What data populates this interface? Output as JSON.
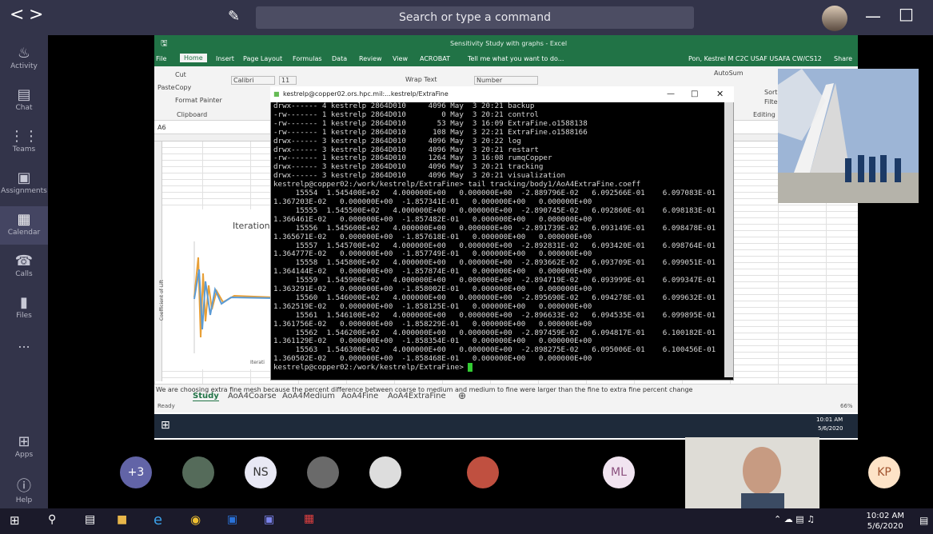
{
  "teams": {
    "search_placeholder": "Search or type a command",
    "nav_back": "<",
    "nav_forward": ">",
    "rail": [
      {
        "label": "Activity",
        "icon": "bell-icon"
      },
      {
        "label": "Chat",
        "icon": "chat-icon"
      },
      {
        "label": "Teams",
        "icon": "teams-icon"
      },
      {
        "label": "Assignments",
        "icon": "assignments-icon"
      },
      {
        "label": "Calendar",
        "icon": "calendar-icon"
      },
      {
        "label": "Calls",
        "icon": "phone-icon"
      },
      {
        "label": "Files",
        "icon": "files-icon"
      },
      {
        "label": "...",
        "icon": "more-icon"
      },
      {
        "label": "Apps",
        "icon": "apps-icon"
      },
      {
        "label": "Help",
        "icon": "help-icon"
      }
    ],
    "participants": [
      {
        "label": "+3",
        "color": "#6264a7"
      },
      {
        "label": "",
        "color": "#7a7a7a"
      },
      {
        "label": "NS",
        "color": "#e8e8f4"
      },
      {
        "label": "",
        "color": "#8a8a8a"
      },
      {
        "label": "",
        "color": "#9a9a9a"
      },
      {
        "label": "",
        "color": "#b04040"
      },
      {
        "label": "ML",
        "color": "#f1e4f0"
      },
      {
        "label": "KP",
        "color": "#fde3c7"
      }
    ]
  },
  "excel": {
    "window_title": "Sensitivity Study with graphs - Excel",
    "user": "Pon, Kestrel M C2C USAF USAFA CW/CS12",
    "share": "Share",
    "menu": [
      "File",
      "Home",
      "Insert",
      "Page Layout",
      "Formulas",
      "Data",
      "Review",
      "View",
      "ACROBAT"
    ],
    "tell_me": "Tell me what you want to do...",
    "ribbon": {
      "cut": "Cut",
      "copy": "Copy",
      "format_painter": "Format Painter",
      "paste": "Paste",
      "clipboard": "Clipboard",
      "font": "Calibri",
      "font_size": "11",
      "wrap_text": "Wrap Text",
      "number_format": "Number",
      "autosum": "AutoSum",
      "sort": "Sort",
      "filter": "Filter",
      "editing": "Editing"
    },
    "name_box": "A6",
    "chart_title": "Iterations",
    "chart_ylabel": "Coefficient of Lift",
    "chart_xlabel": "Iterati",
    "note_row": "We are choosing extra fine mesh because the percent difference between coarse to medium and medium to fine were larger than the fine to extra fine percent change",
    "sheet_tabs": [
      "Study",
      "AoA4Coarse",
      "AoA4Medium",
      "AoA4Fine",
      "AoA4ExtraFine"
    ],
    "status_ready": "Ready",
    "status_zoom": "66%",
    "inner_clock_time": "10:01 AM",
    "inner_clock_date": "5/6/2020"
  },
  "terminal": {
    "title": "kestrelp@copper02.ors.hpc.mil:...kestrelp/ExtraFine",
    "lines": [
      "drwx------ 4 kestrelp 2864D010     4096 May  3 20:21 backup",
      "-rw------- 1 kestrelp 2864D010        0 May  3 20:21 control",
      "-rw------- 1 kestrelp 2864D010       53 May  3 16:09 ExtraFine.o1588138",
      "-rw------- 1 kestrelp 2864D010      108 May  3 22:21 ExtraFine.o1588166",
      "drwx------ 3 kestrelp 2864D010     4096 May  3 20:22 log",
      "drwx------ 3 kestrelp 2864D010     4096 May  3 20:21 restart",
      "-rw------- 1 kestrelp 2864D010     1264 May  3 16:08 rumqCopper",
      "drwx------ 3 kestrelp 2864D010     4096 May  3 20:21 tracking",
      "drwx------ 3 kestrelp 2864D010     4096 May  3 20:21 visualization",
      "kestrelp@copper02:/work/kestrelp/ExtraFine> tail tracking/body1/AoA4ExtraFine.coeff",
      "     15554  1.545400E+02   4.000000E+00   0.000000E+00  -2.889796E-02   6.092566E-01    6.097083E-01",
      "1.367203E-02   0.000000E+00  -1.857341E-01   0.000000E+00   0.000000E+00",
      "     15555  1.545500E+02   4.000000E+00   0.000000E+00  -2.890745E-02   6.092860E-01    6.098183E-01",
      "1.366461E-02   0.000000E+00  -1.857482E-01   0.000000E+00   0.000000E+00",
      "     15556  1.545600E+02   4.000000E+00   0.000000E+00  -2.891739E-02   6.093149E-01    6.098478E-01",
      "1.365671E-02   0.000000E+00  -1.857618E-01   0.000000E+00   0.000000E+00",
      "     15557  1.545700E+02   4.000000E+00   0.000000E+00  -2.892831E-02   6.093420E-01    6.098764E-01",
      "1.364777E-02   0.000000E+00  -1.857749E-01   0.000000E+00   0.000000E+00",
      "     15558  1.545800E+02   4.000000E+00   0.000000E+00  -2.893662E-02   6.093709E-01    6.099051E-01",
      "1.364144E-02   0.000000E+00  -1.857874E-01   0.000000E+00   0.000000E+00",
      "     15559  1.545900E+02   4.000000E+00   0.000000E+00  -2.894719E-02   6.093999E-01    6.099347E-01",
      "1.363291E-02   0.000000E+00  -1.858002E-01   0.000000E+00   0.000000E+00",
      "     15560  1.546000E+02   4.000000E+00   0.000000E+00  -2.895690E-02   6.094278E-01    6.099632E-01",
      "1.362519E-02   0.000000E+00  -1.858125E-01   0.000000E+00   0.000000E+00",
      "     15561  1.546100E+02   4.000000E+00   0.000000E+00  -2.896633E-02   6.094535E-01    6.099895E-01",
      "1.361756E-02   0.000000E+00  -1.858229E-01   0.000000E+00   0.000000E+00",
      "     15562  1.546200E+02   4.000000E+00   0.000000E+00  -2.897459E-02   6.094817E-01    6.100182E-01",
      "1.361129E-02   0.000000E+00  -1.858354E-01   0.000000E+00   0.000000E+00",
      "     15563  1.546300E+02   4.000000E+00   0.000000E+00  -2.898275E-02   6.095006E-01    6.100456E-01",
      "1.360502E-02   0.000000E+00  -1.858468E-01   0.000000E+00   0.000000E+00",
      "kestrelp@copper02:/work/kestrelp/ExtraFine> "
    ]
  },
  "taskbar": {
    "time": "10:02 AM",
    "date": "5/6/2020"
  },
  "colors": {
    "teams_dark": "#33344a",
    "excel_green": "#217346",
    "terminal_bg": "#000000"
  }
}
